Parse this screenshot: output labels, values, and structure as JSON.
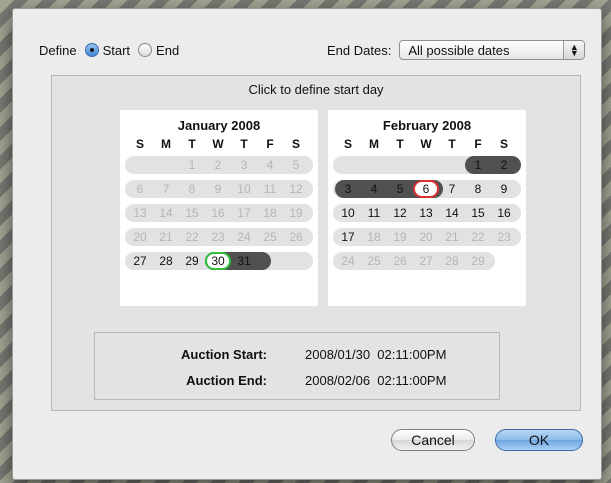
{
  "define": {
    "label": "Define",
    "options": [
      {
        "label": "Start",
        "selected": true
      },
      {
        "label": "End",
        "selected": false
      }
    ]
  },
  "end_dates": {
    "label": "End Dates:",
    "selected": "All possible dates"
  },
  "instruction": "Click to define start day",
  "weekday_headers": [
    "S",
    "M",
    "T",
    "W",
    "T",
    "F",
    "S"
  ],
  "calendars": [
    {
      "title": "January 2008",
      "weeks": [
        [
          "",
          "",
          "1",
          "2",
          "3",
          "4",
          "5"
        ],
        [
          "6",
          "7",
          "8",
          "9",
          "10",
          "11",
          "12"
        ],
        [
          "13",
          "14",
          "15",
          "16",
          "17",
          "18",
          "19"
        ],
        [
          "20",
          "21",
          "22",
          "23",
          "24",
          "25",
          "26"
        ],
        [
          "27",
          "28",
          "29",
          "30",
          "31",
          "",
          ""
        ]
      ]
    },
    {
      "title": "February 2008",
      "weeks": [
        [
          "",
          "",
          "",
          "",
          "",
          "1",
          "2"
        ],
        [
          "3",
          "4",
          "5",
          "6",
          "7",
          "8",
          "9"
        ],
        [
          "10",
          "11",
          "12",
          "13",
          "14",
          "15",
          "16"
        ],
        [
          "17",
          "18",
          "19",
          "20",
          "21",
          "22",
          "23"
        ],
        [
          "24",
          "25",
          "26",
          "27",
          "28",
          "29",
          ""
        ]
      ]
    }
  ],
  "summary": {
    "start_label": "Auction Start:",
    "start_value": "2008/01/30  02:11:00PM",
    "end_label": "Auction End:",
    "end_value": "2008/02/06  02:11:00PM"
  },
  "buttons": {
    "cancel": "Cancel",
    "ok": "OK"
  },
  "colors": {
    "selected_start_ring": "#2fbf3c",
    "selected_end_ring": "#d9322f",
    "range_fill": "#505050"
  }
}
